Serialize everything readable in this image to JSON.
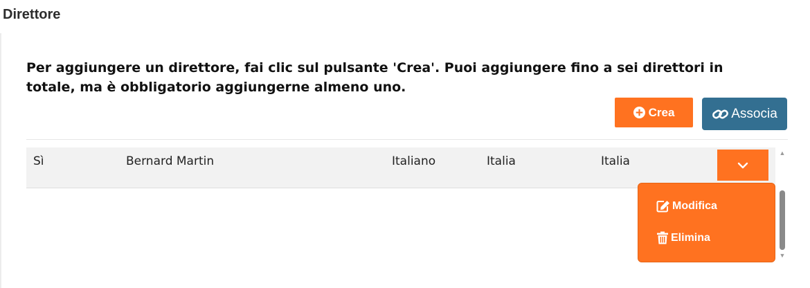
{
  "section": {
    "title": "Direttore"
  },
  "instructions": "Per aggiungere un direttore, fai clic sul pulsante 'Crea'. Puoi aggiungere fino a sei direttori in totale, ma è obbligatorio aggiungerne almeno uno.",
  "actions": {
    "create_label": "Crea",
    "create_icon": "plus-circle-icon",
    "associate_label": "Associa",
    "associate_icon": "link-icon"
  },
  "colors": {
    "accent_orange": "#ff7220",
    "associate_blue": "#336f91",
    "row_background": "#f2f2f2"
  },
  "table": {
    "rows": [
      {
        "cells": [
          "Sì",
          "Bernard Martin",
          "Italiano",
          "Italia",
          "Italia"
        ],
        "toggle_icon": "chevron-down-icon"
      }
    ]
  },
  "row_menu": {
    "items": [
      {
        "label": "Modifica",
        "icon": "edit-icon"
      },
      {
        "label": "Elimina",
        "icon": "trash-icon"
      }
    ]
  }
}
